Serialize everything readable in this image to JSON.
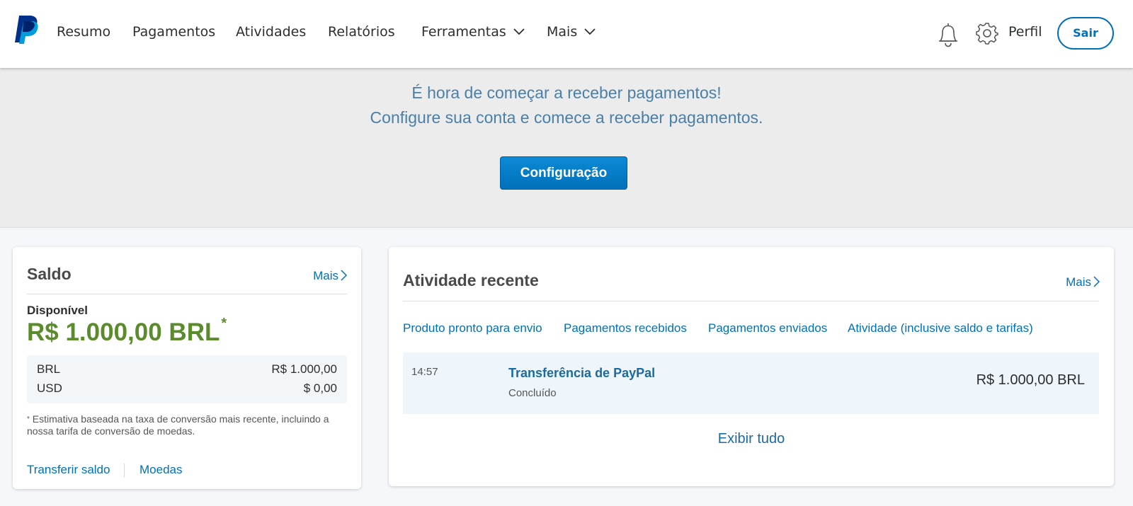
{
  "nav": {
    "items": [
      {
        "label": "Resumo"
      },
      {
        "label": "Pagamentos"
      },
      {
        "label": "Atividades"
      },
      {
        "label": "Relatórios"
      },
      {
        "label": "Ferramentas"
      },
      {
        "label": "Mais"
      }
    ],
    "profile_label": "Perfil",
    "logout_label": "Sair",
    "logo_icon": "paypal-logo-icon",
    "notification_icon": "bell-icon",
    "settings_icon": "gear-icon"
  },
  "banner": {
    "line1": "É hora de começar a receber pagamentos!",
    "line2": "Configure sua conta e comece a receber pagamentos.",
    "button_label": "Configuração"
  },
  "balance": {
    "title": "Saldo",
    "more_label": "Mais",
    "available_label": "Disponível",
    "available_amount": "R$ 1.000,00 BRL",
    "asterisk": "*",
    "currencies": [
      {
        "code": "BRL",
        "amount": "R$ 1.000,00"
      },
      {
        "code": "USD",
        "amount": "$ 0,00"
      }
    ],
    "footnote": "Estimativa baseada na taxa de conversão mais recente, incluindo a nossa tarifa de conversão de moedas.",
    "transfer_label": "Transferir saldo",
    "currencies_label": "Moedas"
  },
  "activity": {
    "title": "Atividade recente",
    "more_label": "Mais",
    "tabs": [
      {
        "label": "Produto pronto para envio"
      },
      {
        "label": "Pagamentos recebidos"
      },
      {
        "label": "Pagamentos enviados"
      },
      {
        "label": "Atividade (inclusive saldo e tarifas)"
      }
    ],
    "rows": [
      {
        "time": "14:57",
        "name": "Transferência de PayPal",
        "status": "Concluído",
        "amount": "R$ 1.000,00 BRL"
      }
    ],
    "view_all_label": "Exibir tudo"
  },
  "colors": {
    "brand_blue": "#0070ba",
    "balance_green": "#5b8c2c",
    "banner_text": "#4a7fa8"
  }
}
